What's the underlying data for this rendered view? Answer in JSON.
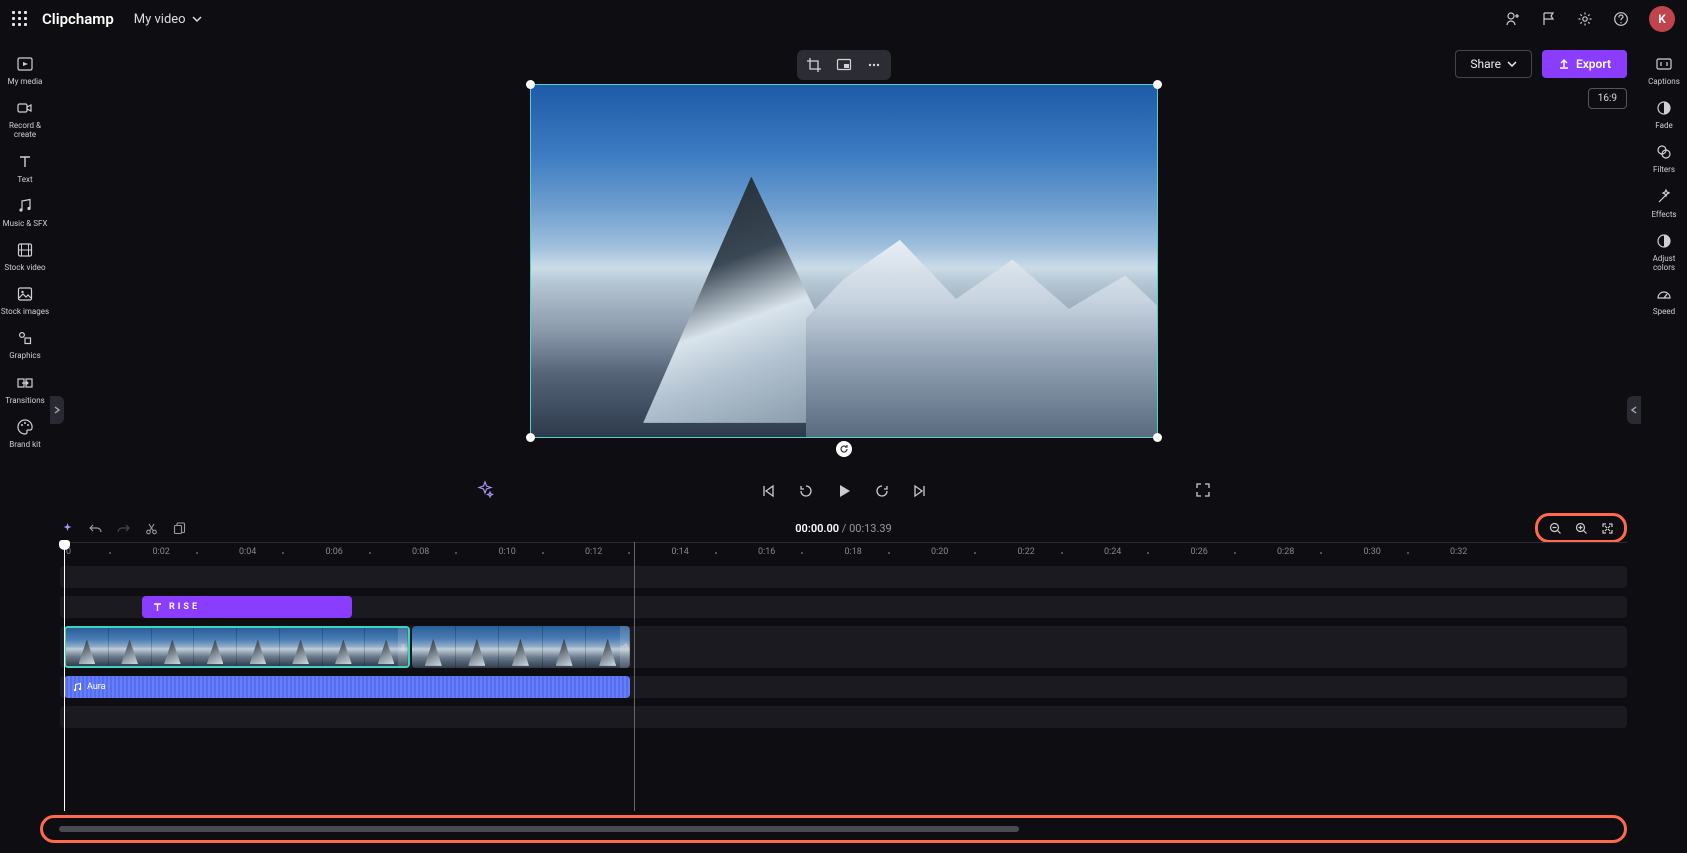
{
  "header": {
    "brand": "Clipchamp",
    "project": "My video",
    "avatar_initial": "K"
  },
  "share_label": "Share",
  "export_label": "Export",
  "aspect_ratio": "16:9",
  "left_sidebar": [
    {
      "label": "My media"
    },
    {
      "label": "Record & create"
    },
    {
      "label": "Text"
    },
    {
      "label": "Music & SFX"
    },
    {
      "label": "Stock video"
    },
    {
      "label": "Stock images"
    },
    {
      "label": "Graphics"
    },
    {
      "label": "Transitions"
    },
    {
      "label": "Brand kit"
    }
  ],
  "right_sidebar": [
    {
      "label": "Captions"
    },
    {
      "label": "Fade"
    },
    {
      "label": "Filters"
    },
    {
      "label": "Effects"
    },
    {
      "label": "Adjust colors"
    },
    {
      "label": "Speed"
    }
  ],
  "time": {
    "current": "00:00.00",
    "total": "00:13.39"
  },
  "ruler": [
    "0",
    "0:02",
    "0:04",
    "0:06",
    "0:08",
    "0:10",
    "0:12",
    "0:14",
    "0:16",
    "0:18",
    "0:20",
    "0:22",
    "0:24",
    "0:26",
    "0:28",
    "0:30",
    "0:32"
  ],
  "clips": {
    "text": {
      "label": "RISE"
    },
    "audio": {
      "label": "Aura"
    }
  },
  "colors": {
    "accent": "#8b3dff",
    "highlight": "#ff6a4a",
    "clip_selected": "#3dd4c1"
  }
}
